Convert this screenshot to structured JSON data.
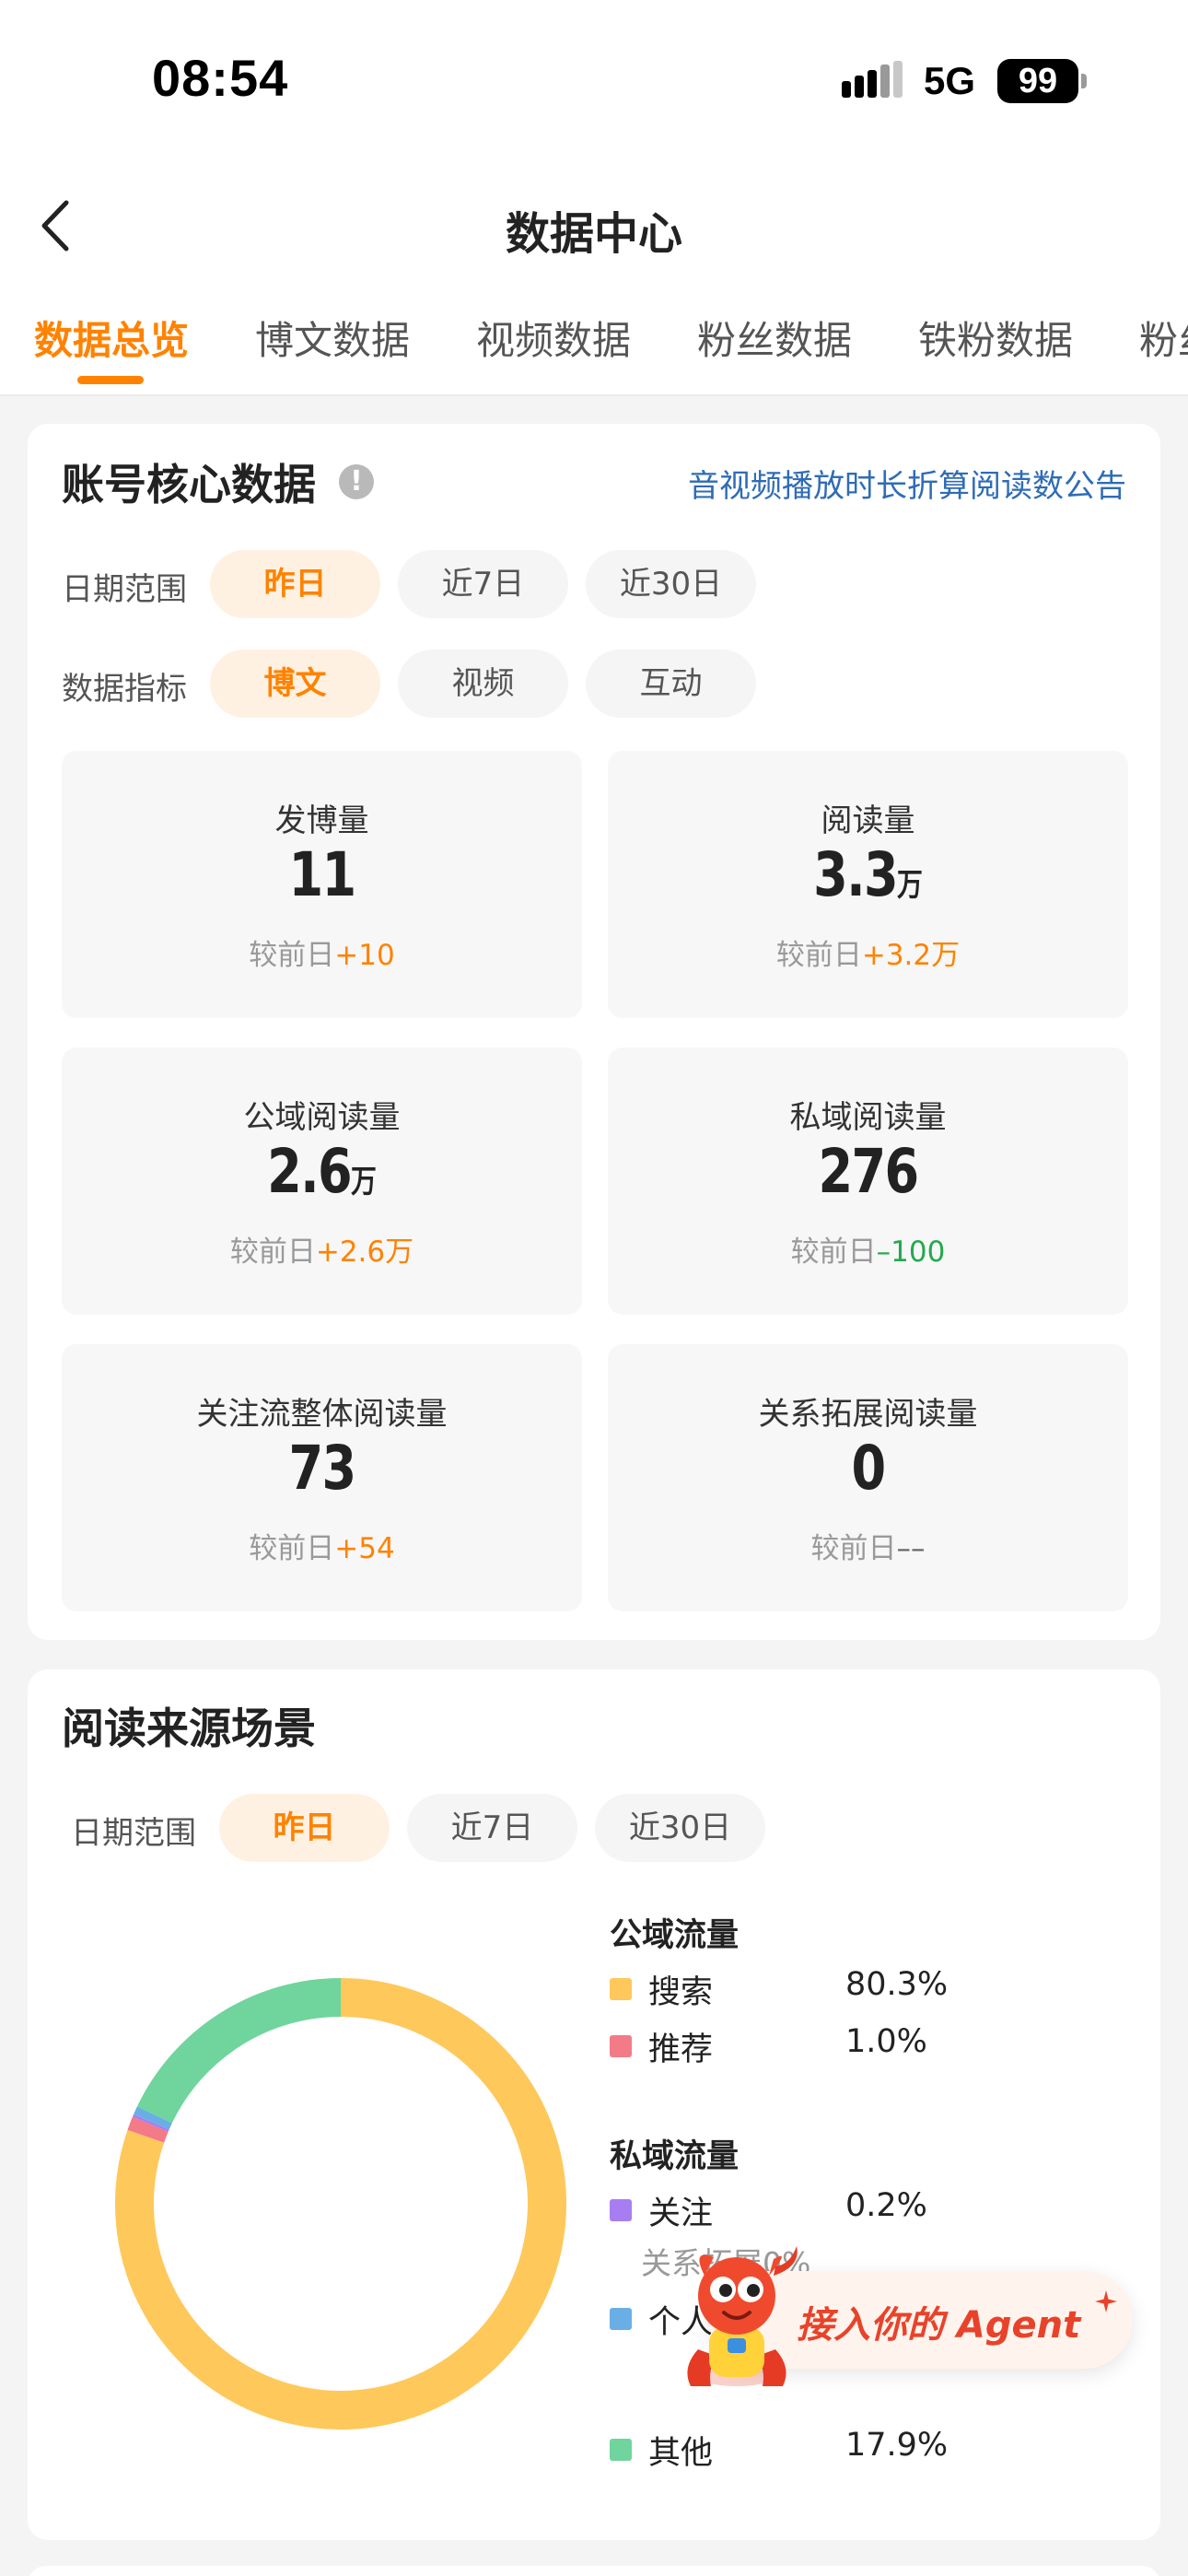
{
  "status_bar": {
    "time": "08:54",
    "network": "5G",
    "battery": "99"
  },
  "header": {
    "title": "数据中心",
    "back_icon": "chevron-left-icon"
  },
  "tabs": [
    {
      "label": "数据总览",
      "active": true
    },
    {
      "label": "博文数据",
      "active": false
    },
    {
      "label": "视频数据",
      "active": false
    },
    {
      "label": "粉丝数据",
      "active": false
    },
    {
      "label": "铁粉数据",
      "active": false
    },
    {
      "label": "粉丝",
      "active": false
    }
  ],
  "core": {
    "title": "账号核心数据",
    "notice_link": "音视频播放时长折算阅读数公告",
    "date_label": "日期范围",
    "date_options": [
      "昨日",
      "近7日",
      "近30日"
    ],
    "metric_label": "数据指标",
    "metric_options": [
      "博文",
      "视频",
      "互动"
    ],
    "compare_prefix": "较前日",
    "stats": [
      {
        "label": "发博量",
        "value": "11",
        "unit": "",
        "delta": "+10",
        "trend": "up"
      },
      {
        "label": "阅读量",
        "value": "3.3",
        "unit": "万",
        "delta": "+3.2万",
        "trend": "up"
      },
      {
        "label": "公域阅读量",
        "value": "2.6",
        "unit": "万",
        "delta": "+2.6万",
        "trend": "up"
      },
      {
        "label": "私域阅读量",
        "value": "276",
        "unit": "",
        "delta": "–100",
        "trend": "down"
      },
      {
        "label": "关注流整体阅读量",
        "value": "73",
        "unit": "",
        "delta": "+54",
        "trend": "up"
      },
      {
        "label": "关系拓展阅读量",
        "value": "0",
        "unit": "",
        "delta": "––",
        "trend": "flat"
      }
    ]
  },
  "source": {
    "title": "阅读来源场景",
    "date_label": "日期范围",
    "date_options": [
      "昨日",
      "近7日",
      "近30日"
    ],
    "public_label": "公域流量",
    "private_label": "私域流量",
    "relation_sub": "关系拓展0%",
    "legend": [
      {
        "name": "搜索",
        "pct": "80.3%",
        "group": "public"
      },
      {
        "name": "推荐",
        "pct": "1.0%",
        "group": "public"
      },
      {
        "name": "关注",
        "pct": "0.2%",
        "group": "private"
      },
      {
        "name": "个人",
        "pct": "",
        "group": "private"
      },
      {
        "name": "其他",
        "pct": "17.9%",
        "group": "private"
      }
    ]
  },
  "chart_data": {
    "type": "pie",
    "series": [
      {
        "name": "搜索",
        "value": 80.3
      },
      {
        "name": "推荐",
        "value": 1.0
      },
      {
        "name": "关注",
        "value": 0.2
      },
      {
        "name": "个人",
        "value": 0.6
      },
      {
        "name": "其他",
        "value": 17.9
      }
    ],
    "donut": true
  },
  "colors": {
    "accent": "#ff8200",
    "search": "#ffc85b",
    "recommend": "#f27b87",
    "follow": "#a77ef2",
    "personal": "#6aaee6",
    "other": "#6fd59d"
  },
  "agent": {
    "label": "接入你的 Agent"
  }
}
